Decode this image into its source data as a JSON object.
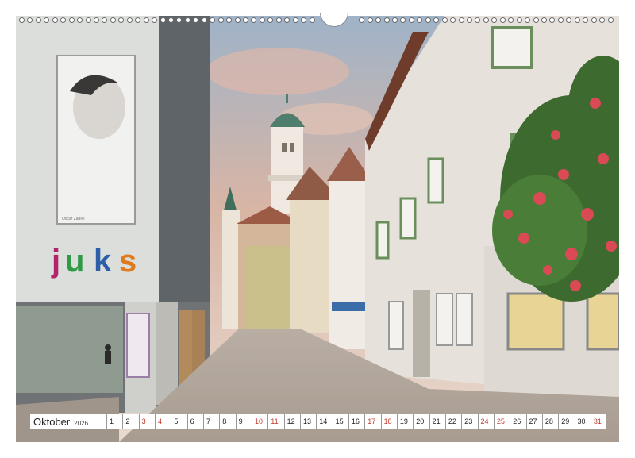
{
  "calendar": {
    "month": "Oktober",
    "year": "2026",
    "days": [
      "1",
      "2",
      "3",
      "4",
      "5",
      "6",
      "7",
      "8",
      "9",
      "10",
      "11",
      "12",
      "13",
      "14",
      "15",
      "16",
      "17",
      "18",
      "19",
      "20",
      "21",
      "22",
      "23",
      "24",
      "25",
      "26",
      "27",
      "28",
      "29",
      "30",
      "31"
    ],
    "weekend_days": [
      "3",
      "4",
      "10",
      "11",
      "17",
      "18",
      "24",
      "25",
      "31"
    ]
  },
  "photo": {
    "sign_text": "juks",
    "sign_letter_colors": [
      "#b3246a",
      "#2e9a44",
      "#2c5fa8",
      "#e07a1f"
    ],
    "poster_caption": "Oscar Zadek"
  },
  "binding": {
    "ring_count": 72
  }
}
